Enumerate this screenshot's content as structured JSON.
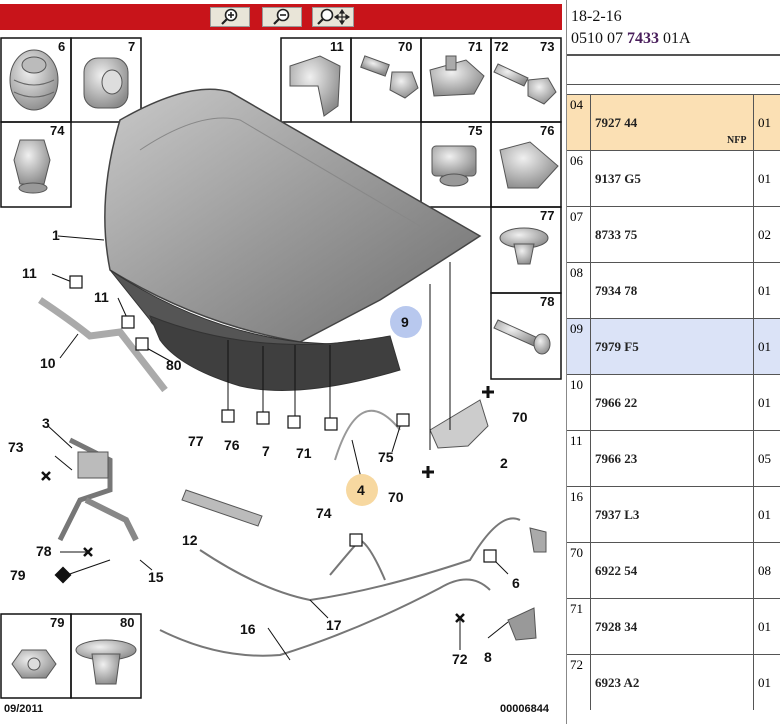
{
  "toolbar": {
    "zoom_in": "zoom-in-icon",
    "zoom_out": "zoom-out-icon",
    "zoom_pan": "zoom-pan-icon",
    "color": "#c8141a"
  },
  "diagram": {
    "footer_date": "09/2011",
    "footer_code": "00006844",
    "parts": {
      "p1": "1",
      "p2": "2",
      "p3": "3",
      "p4": "4",
      "p6": "6",
      "p7": "7",
      "p8": "8",
      "p9": "9",
      "p10": "10",
      "p11a": "11",
      "p11b": "11",
      "p12": "12",
      "p15": "15",
      "p16": "16",
      "p17": "17",
      "p70a": "70",
      "p70b": "70",
      "p71": "71",
      "p72": "72",
      "p73": "73",
      "p74": "74",
      "p75": "75",
      "p76": "76",
      "p77": "77",
      "p78": "78",
      "p79": "79",
      "p80": "80"
    },
    "boxes": {
      "b6": "6",
      "b7": "7",
      "b74": "74",
      "b11": "11",
      "b70": "70",
      "b71": "71",
      "b72": "72",
      "b73": "73",
      "b75": "75",
      "b76": "76",
      "b77": "77",
      "b78": "78",
      "b79": "79",
      "b80": "80"
    }
  },
  "panel": {
    "line1": "18-2-16",
    "line2_prefix": "0510 07 ",
    "line2_bold": "7433",
    "line2_suffix": " 01A",
    "highlight_selected": "#fbe0b4",
    "highlight_hover": "#dbe3f7",
    "rows": [
      {
        "idx": "04",
        "ref": "7927 44",
        "qty": "01",
        "note": "NFP",
        "state": "selected"
      },
      {
        "idx": "06",
        "ref": "9137 G5",
        "qty": "01",
        "note": "",
        "state": ""
      },
      {
        "idx": "07",
        "ref": "8733 75",
        "qty": "02",
        "note": "",
        "state": ""
      },
      {
        "idx": "08",
        "ref": "7934 78",
        "qty": "01",
        "note": "",
        "state": ""
      },
      {
        "idx": "09",
        "ref": "7979 F5",
        "qty": "01",
        "note": "",
        "state": "hover"
      },
      {
        "idx": "10",
        "ref": "7966 22",
        "qty": "01",
        "note": "",
        "state": ""
      },
      {
        "idx": "11",
        "ref": "7966 23",
        "qty": "05",
        "note": "",
        "state": ""
      },
      {
        "idx": "16",
        "ref": "7937 L3",
        "qty": "01",
        "note": "",
        "state": ""
      },
      {
        "idx": "70",
        "ref": "6922 54",
        "qty": "08",
        "note": "",
        "state": ""
      },
      {
        "idx": "71",
        "ref": "7928 34",
        "qty": "01",
        "note": "",
        "state": ""
      },
      {
        "idx": "72",
        "ref": "6923 A2",
        "qty": "01",
        "note": "",
        "state": ""
      }
    ]
  }
}
